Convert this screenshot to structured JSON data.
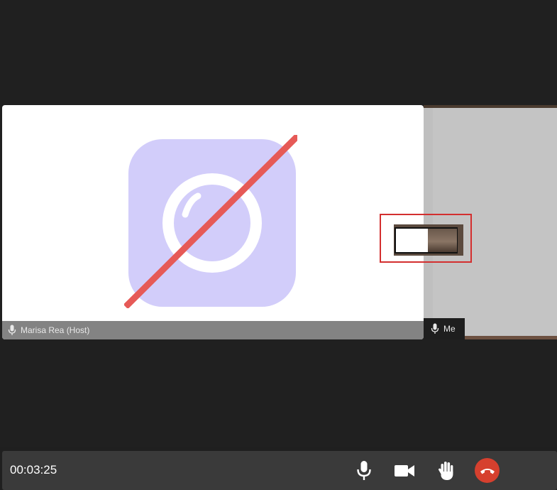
{
  "host_tile": {
    "participant_label": "Marisa Rea (Host)",
    "status_icon": "camera-off-icon",
    "colors": {
      "icon_bg": "#d2cdfa",
      "slash": "#e65a57"
    }
  },
  "self_tile": {
    "participant_label": "Me"
  },
  "controls": {
    "timer": "00:03:25",
    "buttons": [
      {
        "name": "microphone",
        "icon": "microphone-icon"
      },
      {
        "name": "camera",
        "icon": "video-camera-icon"
      },
      {
        "name": "raise-hand",
        "icon": "hand-icon"
      },
      {
        "name": "end-call",
        "icon": "phone-hangup-icon",
        "color": "#d6402e"
      }
    ]
  }
}
